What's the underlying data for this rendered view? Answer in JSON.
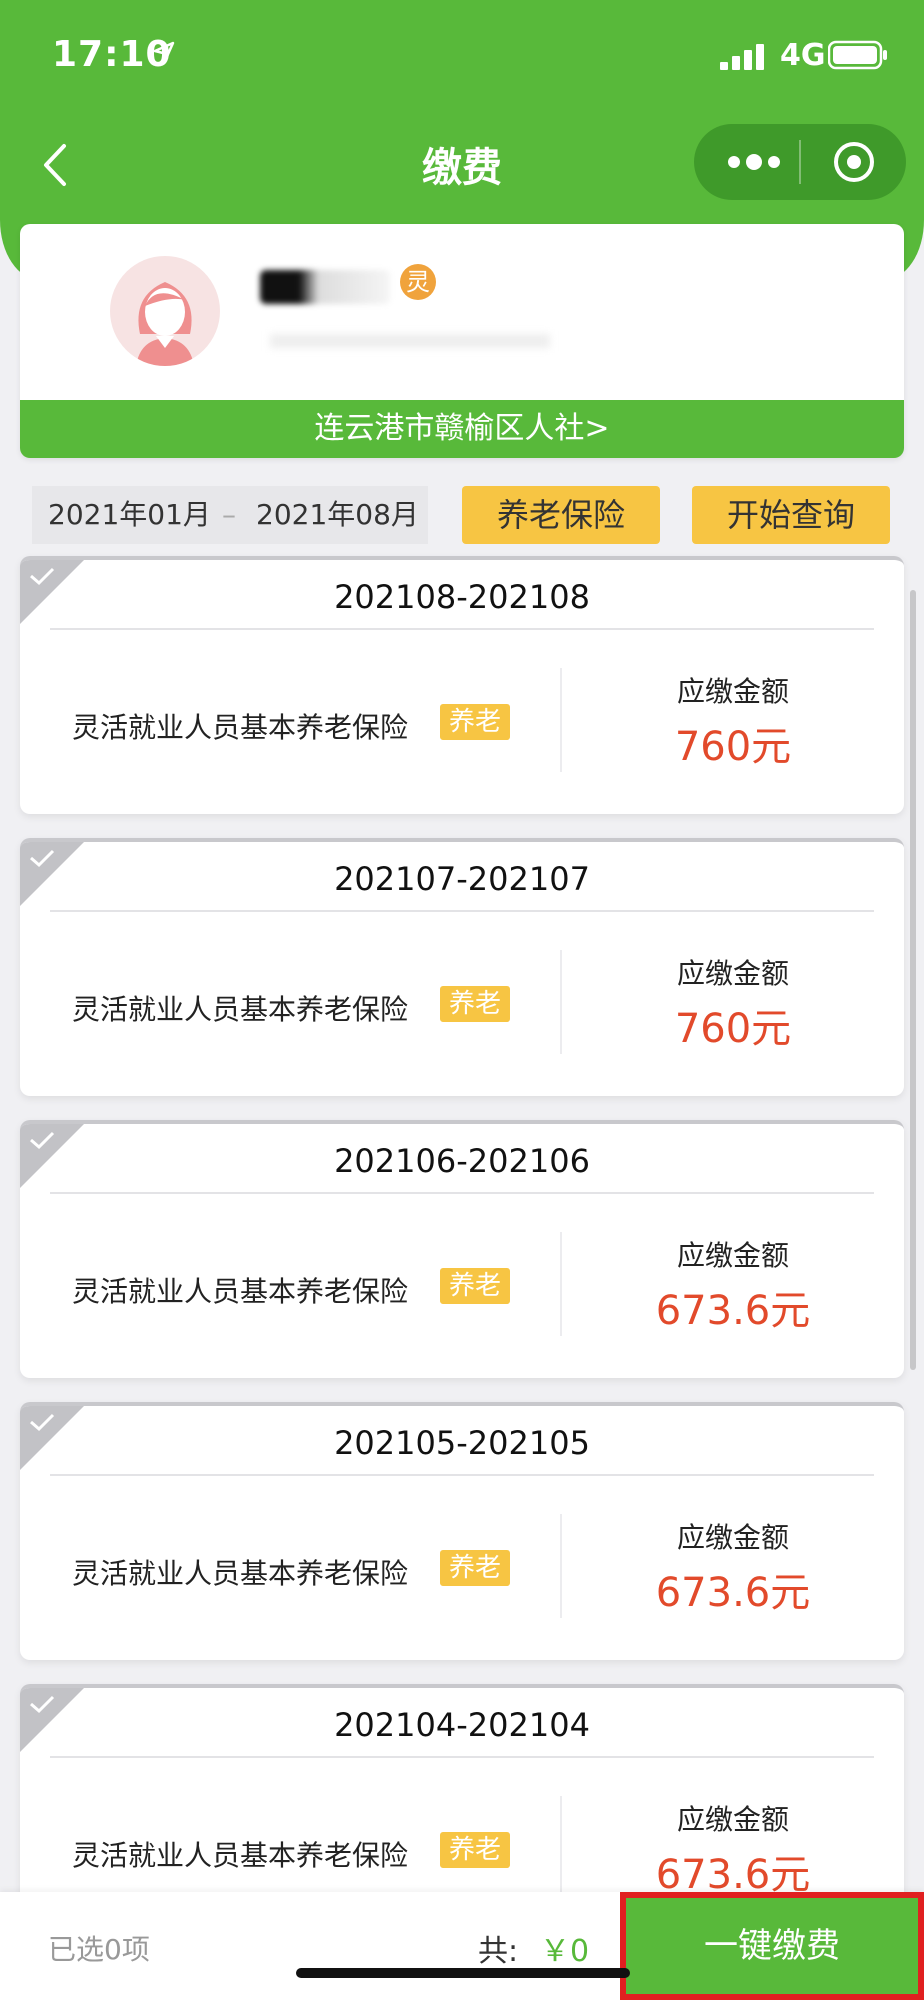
{
  "status_bar": {
    "time": "17:10",
    "network": "4G"
  },
  "nav": {
    "title": "缴费"
  },
  "profile": {
    "badge": "灵",
    "org": "连云港市赣榆区人社>"
  },
  "filter": {
    "start_date": "2021年01月",
    "separator": "–",
    "end_date": "2021年08月",
    "type_label": "养老保险",
    "query_label": "开始查询"
  },
  "records": [
    {
      "period": "202108-202108",
      "name": "灵活就业人员基本养老保险",
      "badge": "养老",
      "amount_label": "应缴金额",
      "amount": "760元"
    },
    {
      "period": "202107-202107",
      "name": "灵活就业人员基本养老保险",
      "badge": "养老",
      "amount_label": "应缴金额",
      "amount": "760元"
    },
    {
      "period": "202106-202106",
      "name": "灵活就业人员基本养老保险",
      "badge": "养老",
      "amount_label": "应缴金额",
      "amount": "673.6元"
    },
    {
      "period": "202105-202105",
      "name": "灵活就业人员基本养老保险",
      "badge": "养老",
      "amount_label": "应缴金额",
      "amount": "673.6元"
    },
    {
      "period": "202104-202104",
      "name": "灵活就业人员基本养老保险",
      "badge": "养老",
      "amount_label": "应缴金额",
      "amount": "673.6元"
    }
  ],
  "footer": {
    "selected": "已选0项",
    "total_label": "共:",
    "total_value": "￥0",
    "pay_button": "一键缴费"
  },
  "colors": {
    "brand_green": "#58b93a",
    "amount_red": "#e24a2b",
    "badge_yellow": "#f7c543",
    "highlight_border": "#e02020"
  }
}
